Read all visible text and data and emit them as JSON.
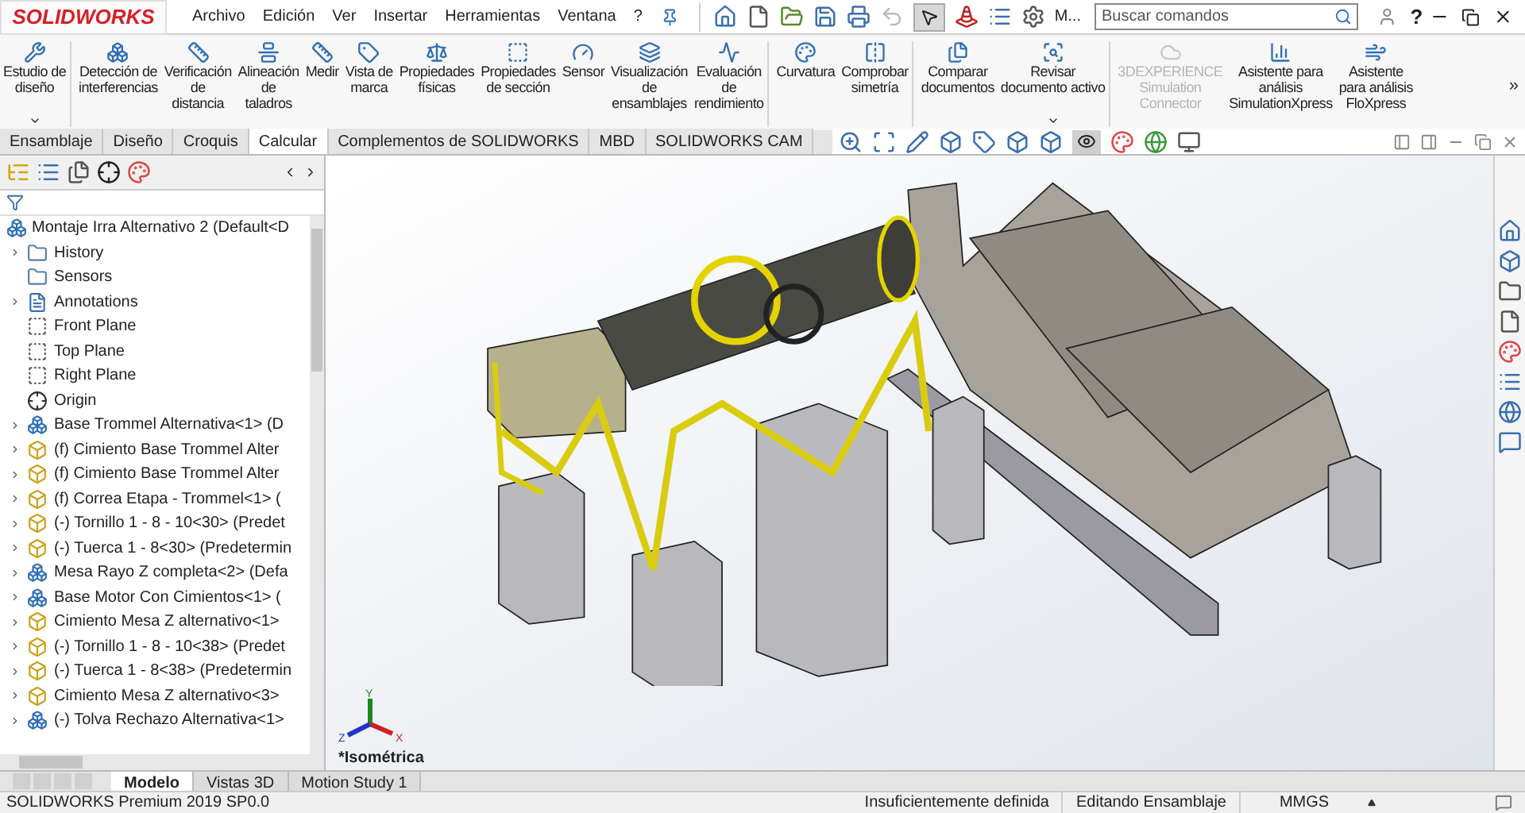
{
  "title_bar": {
    "logo": "SOLIDWORKS",
    "menus": [
      "Archivo",
      "Edición",
      "Ver",
      "Insertar",
      "Herramientas",
      "Ventana",
      "?"
    ],
    "macro_label": "M...",
    "search": {
      "placeholder": "Buscar comandos"
    },
    "help": "?"
  },
  "ribbon": [
    {
      "label": "Estudio de\ndiseño",
      "has_menu": true,
      "disabled": false,
      "group_end": true
    },
    {
      "label": "Detección de\ninterferencias",
      "has_menu": false,
      "disabled": false,
      "group_end": false
    },
    {
      "label": "Verificación\nde\ndistancia",
      "has_menu": false,
      "disabled": false,
      "group_end": false
    },
    {
      "label": "Alineación\nde\ntaladros",
      "has_menu": false,
      "disabled": false,
      "group_end": false
    },
    {
      "label": "Medir",
      "has_menu": false,
      "disabled": false,
      "group_end": false
    },
    {
      "label": "Vista de\nmarca",
      "has_menu": false,
      "disabled": false,
      "group_end": false
    },
    {
      "label": "Propiedades\nfísicas",
      "has_menu": false,
      "disabled": false,
      "group_end": false
    },
    {
      "label": "Propiedades\nde sección",
      "has_menu": false,
      "disabled": false,
      "group_end": false
    },
    {
      "label": "Sensor",
      "has_menu": false,
      "disabled": false,
      "group_end": false
    },
    {
      "label": "Visualización\nde\nensamblajes",
      "has_menu": false,
      "disabled": false,
      "group_end": false
    },
    {
      "label": "Evaluación\nde\nrendimiento",
      "has_menu": false,
      "disabled": false,
      "group_end": true
    },
    {
      "label": "Curvatura",
      "has_menu": false,
      "disabled": false,
      "group_end": false
    },
    {
      "label": "Comprobar\nsimetría",
      "has_menu": false,
      "disabled": false,
      "group_end": true
    },
    {
      "label": "Comparar\ndocumentos",
      "has_menu": false,
      "disabled": false,
      "group_end": false
    },
    {
      "label": "Revisar\ndocumento activo",
      "has_menu": true,
      "disabled": false,
      "group_end": true
    },
    {
      "label": "3DEXPERIENCE\nSimulation\nConnector",
      "has_menu": false,
      "disabled": true,
      "group_end": false
    },
    {
      "label": "Asistente para\nanálisis\nSimulationXpress",
      "has_menu": false,
      "disabled": false,
      "group_end": false
    },
    {
      "label": "Asistente\npara análisis\nFloXpress",
      "has_menu": false,
      "disabled": false,
      "group_end": false
    }
  ],
  "ribbon_more": "»",
  "command_tabs": [
    {
      "label": "Ensamblaje",
      "selected": false
    },
    {
      "label": "Diseño",
      "selected": false
    },
    {
      "label": "Croquis",
      "selected": false
    },
    {
      "label": "Calcular",
      "selected": true
    },
    {
      "label": "Complementos de SOLIDWORKS",
      "selected": false
    },
    {
      "label": "MBD",
      "selected": false
    },
    {
      "label": "SOLIDWORKS CAM",
      "selected": false
    }
  ],
  "feature_tree": {
    "root": {
      "label": "Montaje Irra Alternativo 2  (Default<D",
      "children": [
        {
          "label": "History",
          "kind": "folder",
          "expandable": true
        },
        {
          "label": "Sensors",
          "kind": "folder",
          "expandable": false
        },
        {
          "label": "Annotations",
          "kind": "annotations",
          "expandable": true
        },
        {
          "label": "Front Plane",
          "kind": "plane",
          "expandable": false
        },
        {
          "label": "Top Plane",
          "kind": "plane",
          "expandable": false
        },
        {
          "label": "Right Plane",
          "kind": "plane",
          "expandable": false
        },
        {
          "label": "Origin",
          "kind": "origin",
          "expandable": false
        },
        {
          "label": "Base Trommel Alternativa<1> (D",
          "kind": "assembly",
          "expandable": true
        },
        {
          "label": "(f) Cimiento Base Trommel Alter",
          "kind": "part",
          "expandable": true
        },
        {
          "label": "(f) Cimiento Base Trommel Alter",
          "kind": "part",
          "expandable": true
        },
        {
          "label": "(f) Correa Etapa - Trommel<1> (",
          "kind": "part",
          "expandable": true
        },
        {
          "label": "(-) Tornillo 1 - 8 - 10<30> (Predet",
          "kind": "part",
          "expandable": true
        },
        {
          "label": "(-) Tuerca 1 - 8<30> (Predetermin",
          "kind": "part",
          "expandable": true
        },
        {
          "label": "Mesa Rayo Z completa<2> (Defa",
          "kind": "assembly",
          "expandable": true
        },
        {
          "label": "Base Motor Con Cimientos<1> (",
          "kind": "assembly",
          "expandable": true
        },
        {
          "label": "Cimiento Mesa Z alternativo<1>",
          "kind": "part",
          "expandable": true
        },
        {
          "label": "(-) Tornillo 1 - 8 - 10<38> (Predet",
          "kind": "part",
          "expandable": true
        },
        {
          "label": "(-) Tuerca 1 - 8<38> (Predetermin",
          "kind": "part",
          "expandable": true
        },
        {
          "label": "Cimiento Mesa Z alternativo<3>",
          "kind": "part",
          "expandable": true
        },
        {
          "label": "(-) Tolva Rechazo Alternativa<1>",
          "kind": "assembly",
          "expandable": true
        }
      ]
    }
  },
  "viewport": {
    "view_name": "*Isométrica",
    "triad": {
      "x": "X",
      "y": "Y",
      "z": "Z"
    }
  },
  "bottom_tabs": [
    {
      "label": "Modelo",
      "selected": true
    },
    {
      "label": "Vistas 3D",
      "selected": false
    },
    {
      "label": "Motion Study 1",
      "selected": false
    }
  ],
  "status_bar": {
    "product": "SOLIDWORKS Premium 2019 SP0.0",
    "definition": "Insuficientemente definida",
    "mode": "Editando Ensamblaje",
    "units": "MMGS"
  }
}
